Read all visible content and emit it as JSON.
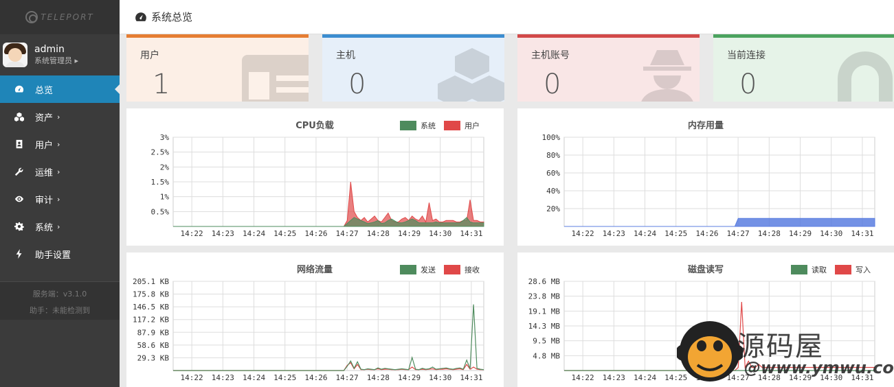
{
  "app": {
    "logo_text": "TELEPORT"
  },
  "user": {
    "name": "admin",
    "role": "系统管理员 ▸"
  },
  "nav": [
    {
      "label": "总览",
      "icon": "dashboard-icon",
      "chevron": ""
    },
    {
      "label": "资产",
      "icon": "cubes-icon",
      "chevron": "›"
    },
    {
      "label": "用户",
      "icon": "user-card-icon",
      "chevron": "›"
    },
    {
      "label": "运维",
      "icon": "wrench-icon",
      "chevron": "›"
    },
    {
      "label": "审计",
      "icon": "eye-icon",
      "chevron": "›"
    },
    {
      "label": "系统",
      "icon": "gear-icon",
      "chevron": "›"
    },
    {
      "label": "助手设置",
      "icon": "bolt-icon",
      "chevron": ""
    }
  ],
  "footer": {
    "server": "服务端：v3.1.0",
    "assistant": "助手：未能检测到"
  },
  "header": {
    "title": "系统总览"
  },
  "cards": [
    {
      "title": "用户",
      "value": "1",
      "color": "#e67e33",
      "bg": "#fcefe6",
      "icon": "id-card-icon"
    },
    {
      "title": "主机",
      "value": "0",
      "color": "#3c8dd0",
      "bg": "#e6eff9",
      "icon": "cubes-icon"
    },
    {
      "title": "主机账号",
      "value": "0",
      "color": "#d24949",
      "bg": "#f9e6e6",
      "icon": "user-secret-icon"
    },
    {
      "title": "当前连接",
      "value": "0",
      "color": "#4ba35f",
      "bg": "#e6f3e8",
      "icon": "link-icon"
    }
  ],
  "legend_colors": {
    "green": "#4e8b5d",
    "red": "#e04848",
    "blue": "#5b7ee0"
  },
  "chart_data": [
    {
      "type": "area",
      "title": "CPU负载",
      "x": [
        "14:22",
        "14:23",
        "14:24",
        "14:25",
        "14:26",
        "14:27",
        "14:28",
        "14:29",
        "14:30",
        "14:31"
      ],
      "y_ticks": [
        "3%",
        "2.5%",
        "2%",
        "1.5%",
        "1%",
        "0.5%"
      ],
      "ylim": [
        0,
        3
      ],
      "series": [
        {
          "name": "系统",
          "color": "#4e8b5d",
          "values": [
            0,
            0,
            0,
            0,
            0,
            0,
            0,
            0,
            0,
            0,
            0,
            0,
            0,
            0,
            0,
            0,
            0,
            0,
            0,
            0,
            0,
            0,
            0,
            0,
            0,
            0,
            0,
            0,
            0,
            0,
            0,
            0,
            0,
            0,
            0,
            0,
            0,
            0,
            0,
            0,
            0,
            0,
            0,
            0,
            0,
            0,
            0,
            0,
            0,
            0,
            0,
            0.1,
            0.2,
            0.3,
            0.25,
            0.2,
            0.15,
            0.1,
            0.12,
            0.15,
            0.2,
            0.1,
            0.12,
            0.2,
            0.25,
            0.18,
            0.12,
            0.12,
            0.15,
            0.2,
            0.25,
            0.2,
            0.12,
            0.12,
            0.12,
            0.12,
            0.12,
            0.15,
            0.12,
            0.12,
            0.12,
            0.12,
            0.12,
            0.12,
            0.12,
            0.2,
            0.3,
            0.15,
            0.12,
            0.12,
            0.12,
            0.12
          ]
        },
        {
          "name": "用户",
          "color": "#e04848",
          "values": [
            0,
            0,
            0,
            0,
            0,
            0,
            0,
            0,
            0,
            0,
            0,
            0,
            0,
            0,
            0,
            0,
            0,
            0,
            0,
            0,
            0,
            0,
            0,
            0,
            0,
            0,
            0,
            0,
            0,
            0,
            0,
            0,
            0,
            0,
            0,
            0,
            0,
            0,
            0,
            0,
            0,
            0,
            0,
            0,
            0,
            0,
            0,
            0,
            0,
            0,
            0,
            0.2,
            1.5,
            0.5,
            0.3,
            0.2,
            0.3,
            0.15,
            0.25,
            0.35,
            0.2,
            0.15,
            0.3,
            0.45,
            0.2,
            0.15,
            0.15,
            0.25,
            0.3,
            0.2,
            0.35,
            0.25,
            0.2,
            0.35,
            0.15,
            0.8,
            0.2,
            0.25,
            0.15,
            0.15,
            0.2,
            0.2,
            0.2,
            0.15,
            0.15,
            0.2,
            0.2,
            0.9,
            0.2,
            0.2,
            0.15,
            0.15
          ]
        }
      ]
    },
    {
      "type": "area",
      "title": "内存用量",
      "x": [
        "14:22",
        "14:23",
        "14:24",
        "14:25",
        "14:26",
        "14:27",
        "14:28",
        "14:29",
        "14:30",
        "14:31"
      ],
      "y_ticks": [
        "100%",
        "80%",
        "60%",
        "40%",
        "20%"
      ],
      "ylim": [
        0,
        100
      ],
      "series": [
        {
          "name": "",
          "color": "#5b7ee0",
          "values": [
            0,
            0,
            0,
            0,
            0,
            0,
            0,
            0,
            0,
            0,
            0,
            0,
            0,
            0,
            0,
            0,
            0,
            0,
            0,
            0,
            0,
            0,
            0,
            0,
            0,
            0,
            0,
            0,
            0,
            0,
            0,
            0,
            0,
            0,
            0,
            0,
            0,
            0,
            0,
            0,
            0,
            0,
            0,
            0,
            0,
            0,
            0,
            0,
            0,
            0,
            0,
            9,
            9,
            9,
            9,
            9,
            9,
            9,
            9,
            9,
            9,
            9,
            9,
            9,
            9,
            9,
            9,
            9,
            9,
            9,
            9,
            9,
            9,
            9,
            9,
            9,
            9,
            9,
            9,
            9,
            9,
            9,
            9,
            9,
            9,
            9,
            9,
            9,
            9,
            9,
            9,
            9
          ]
        }
      ]
    },
    {
      "type": "line",
      "title": "网络流量",
      "x": [
        "14:22",
        "14:23",
        "14:24",
        "14:25",
        "14:26",
        "14:27",
        "14:28",
        "14:29",
        "14:30",
        "14:31"
      ],
      "y_ticks": [
        "205.1 KB",
        "175.8 KB",
        "146.5 KB",
        "117.2 KB",
        "87.9 KB",
        "58.6 KB",
        "29.3 KB"
      ],
      "ylim": [
        0,
        205.1
      ],
      "series": [
        {
          "name": "发送",
          "color": "#4e8b5d",
          "values": [
            0,
            0,
            0,
            0,
            0,
            0,
            0,
            0,
            0,
            0,
            0,
            0,
            0,
            0,
            0,
            0,
            0,
            0,
            0,
            0,
            0,
            0,
            0,
            0,
            0,
            0,
            0,
            0,
            0,
            0,
            0,
            0,
            0,
            0,
            0,
            0,
            0,
            0,
            0,
            0,
            0,
            0,
            0,
            0,
            0,
            0,
            0,
            0,
            0,
            0,
            0,
            10,
            22,
            5,
            20,
            3,
            2,
            4,
            3,
            2,
            6,
            3,
            5,
            4,
            3,
            2,
            3,
            4,
            3,
            2,
            30,
            3,
            2,
            5,
            3,
            4,
            8,
            3,
            4,
            5,
            6,
            4,
            3,
            5,
            6,
            3,
            24,
            4,
            152,
            5,
            3,
            2
          ]
        },
        {
          "name": "接收",
          "color": "#e04848",
          "values": [
            0,
            0,
            0,
            0,
            0,
            0,
            0,
            0,
            0,
            0,
            0,
            0,
            0,
            0,
            0,
            0,
            0,
            0,
            0,
            0,
            0,
            0,
            0,
            0,
            0,
            0,
            0,
            0,
            0,
            0,
            0,
            0,
            0,
            0,
            0,
            0,
            0,
            0,
            0,
            0,
            0,
            0,
            0,
            0,
            0,
            0,
            0,
            0,
            0,
            0,
            0,
            12,
            18,
            4,
            14,
            2,
            2,
            3,
            2,
            2,
            4,
            2,
            3,
            3,
            2,
            2,
            2,
            3,
            2,
            2,
            8,
            2,
            2,
            3,
            2,
            3,
            4,
            2,
            3,
            3,
            4,
            3,
            2,
            3,
            4,
            2,
            14,
            3,
            8,
            3,
            2,
            2
          ]
        }
      ]
    },
    {
      "type": "line",
      "title": "磁盘读写",
      "x": [
        "14:22",
        "14:23",
        "14:24",
        "14:25",
        "14:26",
        "14:27",
        "14:28",
        "14:29",
        "14:30",
        "14:31"
      ],
      "y_ticks": [
        "28.6 MB",
        "23.8 MB",
        "19.1 MB",
        "14.3 MB",
        "9.5 MB",
        "4.8 MB"
      ],
      "ylim": [
        0,
        28.6
      ],
      "series": [
        {
          "name": "读取",
          "color": "#4e8b5d",
          "values": [
            0,
            0,
            0,
            0,
            0,
            0,
            0,
            0,
            0,
            0,
            0,
            0,
            0,
            0,
            0,
            0,
            0,
            0,
            0,
            0,
            0,
            0,
            0,
            0,
            0,
            0,
            0,
            0,
            0,
            0,
            0,
            0,
            0,
            0,
            0,
            0,
            0,
            0,
            0,
            0,
            0,
            0,
            0,
            0,
            0,
            0,
            0,
            0,
            0,
            0,
            0,
            0,
            0,
            0,
            0,
            0,
            0,
            0,
            0,
            0,
            0,
            0,
            0,
            0,
            0,
            0,
            0,
            0,
            0,
            0,
            0,
            0,
            0,
            0,
            0,
            0,
            0,
            0,
            0,
            0,
            0,
            0,
            0,
            0,
            0,
            0,
            0,
            0,
            0,
            0,
            0,
            0
          ]
        },
        {
          "name": "写入",
          "color": "#e04848",
          "values": [
            0,
            0,
            0,
            0,
            0,
            0,
            0,
            0,
            0,
            0,
            0,
            0,
            0,
            0,
            0,
            0,
            0,
            0,
            0,
            0,
            0,
            0,
            0,
            0,
            0,
            0,
            0,
            0,
            0,
            0,
            0,
            0,
            0,
            0,
            0,
            0,
            0,
            0,
            0,
            0,
            0,
            0,
            0,
            0,
            0,
            0,
            0,
            0,
            0,
            0,
            0,
            1,
            22,
            1,
            3,
            1,
            1,
            2,
            1,
            1,
            1,
            1,
            1,
            1,
            1,
            1,
            1,
            1,
            1,
            1,
            1,
            1,
            1,
            1,
            1,
            1,
            1,
            1,
            1,
            1,
            1,
            1,
            1,
            1,
            1,
            1,
            1,
            1,
            1,
            1,
            1,
            1
          ]
        }
      ]
    }
  ],
  "watermark": {
    "line1": "源码屋",
    "line2": "@www.ymwu.com"
  }
}
